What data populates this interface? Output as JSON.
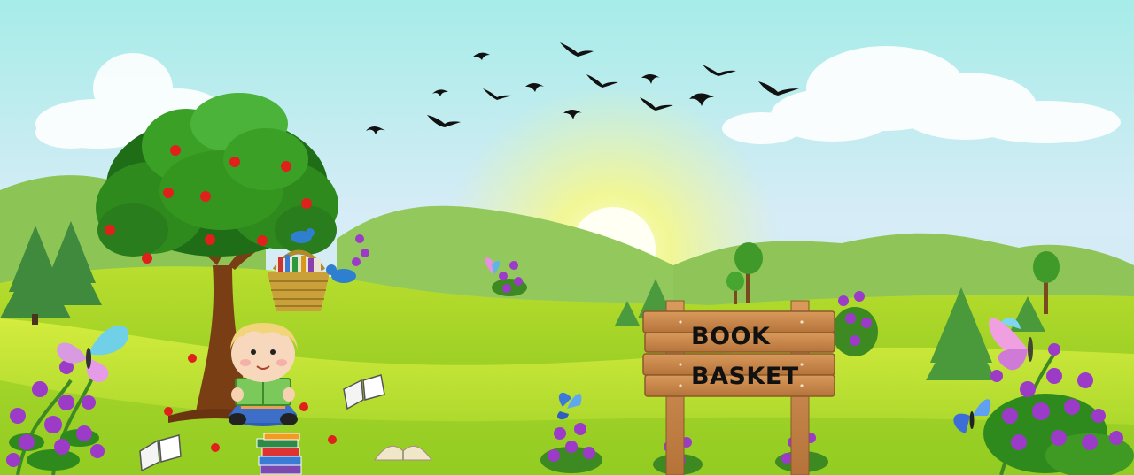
{
  "sign": {
    "line1": "BOOK",
    "line2": "BASKET"
  },
  "colors": {
    "sky_top": "#a8ecec",
    "sky_mid": "#d8eef8",
    "sun_glow": "#f6f9a0",
    "grass_light": "#c9e633",
    "grass_dark": "#6fb31a",
    "hill": "#9ccc5a",
    "tree_foliage": "#2f8a1e",
    "trunk": "#7a3e15",
    "apple": "#e0201b",
    "flower": "#9b3bc8",
    "wood": "#c8874a",
    "bird": "#111111"
  },
  "icons": {
    "birds": "flying-birds",
    "sun": "sun",
    "tree": "apple-tree",
    "basket": "book-basket",
    "boy": "boy-reading-book",
    "butterflies": "butterfly",
    "flowers": "purple-flower-bush",
    "books": "open-book",
    "sign": "wooden-signpost"
  }
}
